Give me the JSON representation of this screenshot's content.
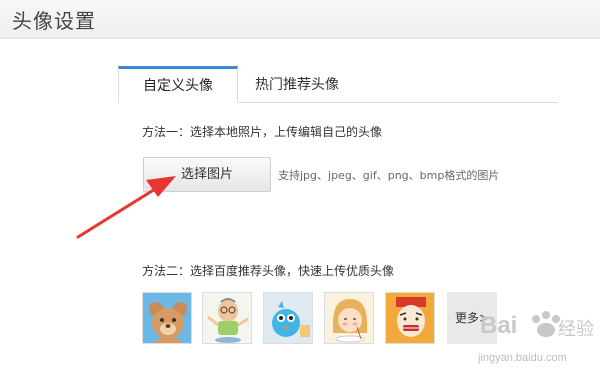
{
  "header": {
    "title": "头像设置"
  },
  "tabs": [
    {
      "label": "自定义头像",
      "active": true
    },
    {
      "label": "热门推荐头像",
      "active": false
    }
  ],
  "method1": {
    "text": "方法一：选择本地照片，上传编辑自己的头像",
    "button_label": "选择图片",
    "format_hint": "支持jpg、jpeg、gif、png、bmp格式的图片"
  },
  "method2": {
    "text": "方法二：选择百度推荐头像，快速上传优质头像",
    "avatars": [
      "bear-avatar",
      "old-man-avatar",
      "blue-bird-avatar",
      "girl-eating-avatar",
      "costume-avatar"
    ],
    "more_label": "更多>"
  },
  "watermark": {
    "brand": "Bai",
    "site": "jingyan.baidu.com"
  },
  "colors": {
    "tab_accent": "#3b86d6",
    "arrow": "#e8352e"
  }
}
